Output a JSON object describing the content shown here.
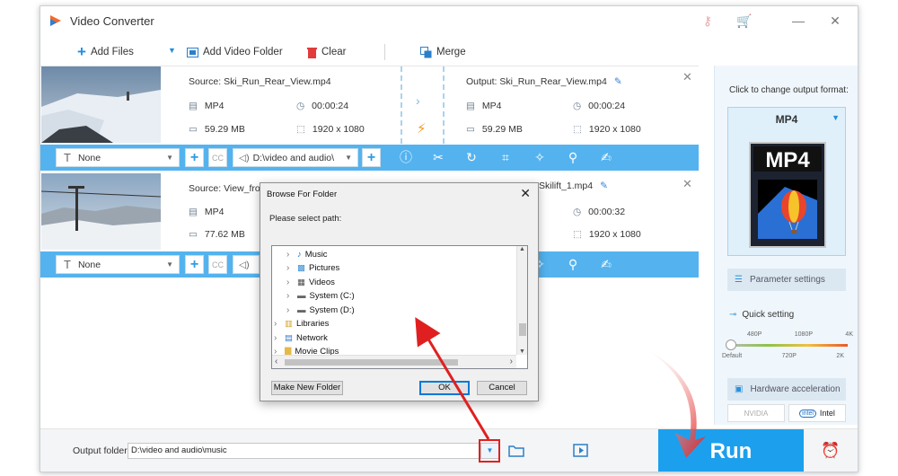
{
  "app": {
    "title": "Video Converter"
  },
  "toolbar": {
    "add_files": "Add Files",
    "add_video_folder": "Add Video Folder",
    "clear": "Clear",
    "merge": "Merge"
  },
  "files": [
    {
      "source": "Source: Ski_Run_Rear_View.mp4",
      "src_format": "MP4",
      "src_duration": "00:00:24",
      "src_size": "59.29 MB",
      "src_resolution": "1920 x 1080",
      "output": "Output: Ski_Run_Rear_View.mp4",
      "out_format": "MP4",
      "out_duration": "00:00:24",
      "out_size": "59.29 MB",
      "out_resolution": "1920 x 1080",
      "subtitle": "None",
      "audio": "D:\\video and audio\\"
    },
    {
      "source": "Source: View_from",
      "src_format": "MP4",
      "src_size": "77.62 MB",
      "output": "Skilift_1.mp4",
      "out_duration": "00:00:32",
      "out_resolution": "1920 x 1080",
      "subtitle": "None"
    }
  ],
  "sidebar": {
    "format_label": "Click to change output format:",
    "format": "MP4",
    "param_settings": "Parameter settings",
    "quick_setting": "Quick setting",
    "quality_top": [
      "480P",
      "1080P",
      "4K"
    ],
    "quality_bottom": [
      "Default",
      "720P",
      "2K"
    ],
    "hw_accel": "Hardware acceleration",
    "gpu_nvidia": "NVIDIA",
    "gpu_intel": "Intel"
  },
  "bottom": {
    "output_label": "Output folder:",
    "output_path": "D:\\video and audio\\music",
    "run": "Run"
  },
  "dialog": {
    "title": "Browse For Folder",
    "message": "Please select path:",
    "tree": [
      "Music",
      "Pictures",
      "Videos",
      "System (C:)",
      "System (D:)",
      "Libraries",
      "Network",
      "Movie Clips"
    ],
    "make_new_folder": "Make New Folder",
    "ok": "OK",
    "cancel": "Cancel"
  },
  "colors": {
    "accent": "#54b3ef",
    "run": "#1ca0ee",
    "annotation": "#e02020"
  }
}
